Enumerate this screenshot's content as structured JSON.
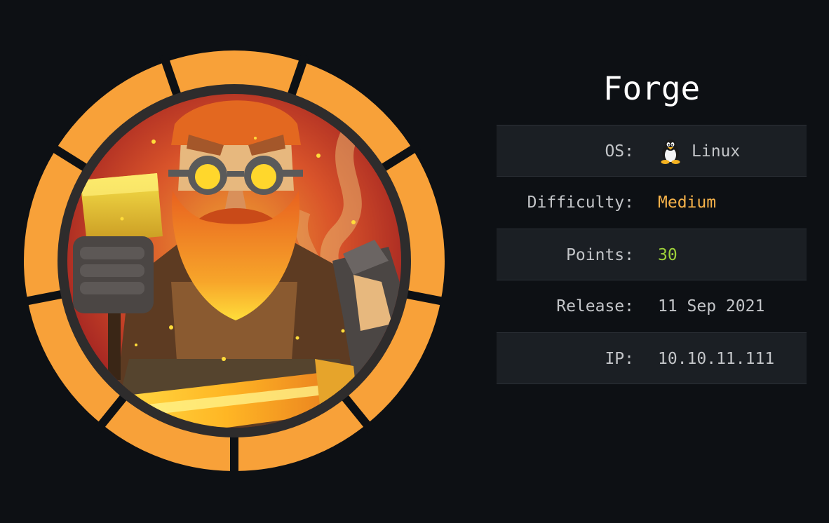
{
  "machine": {
    "name": "Forge",
    "avatar_icon": "forge-blacksmith-avatar",
    "colors": {
      "background": "#0d1014",
      "ring": "#f8a139",
      "difficulty_medium": "#f6b24a",
      "points": "#9ed13a"
    }
  },
  "info": {
    "os": {
      "label": "OS:",
      "value": "Linux",
      "icon": "linux-tux-icon"
    },
    "difficulty": {
      "label": "Difficulty:",
      "value": "Medium"
    },
    "points": {
      "label": "Points:",
      "value": "30"
    },
    "release": {
      "label": "Release:",
      "value": "11 Sep 2021"
    },
    "ip": {
      "label": "IP:",
      "value": "10.10.11.111"
    }
  }
}
